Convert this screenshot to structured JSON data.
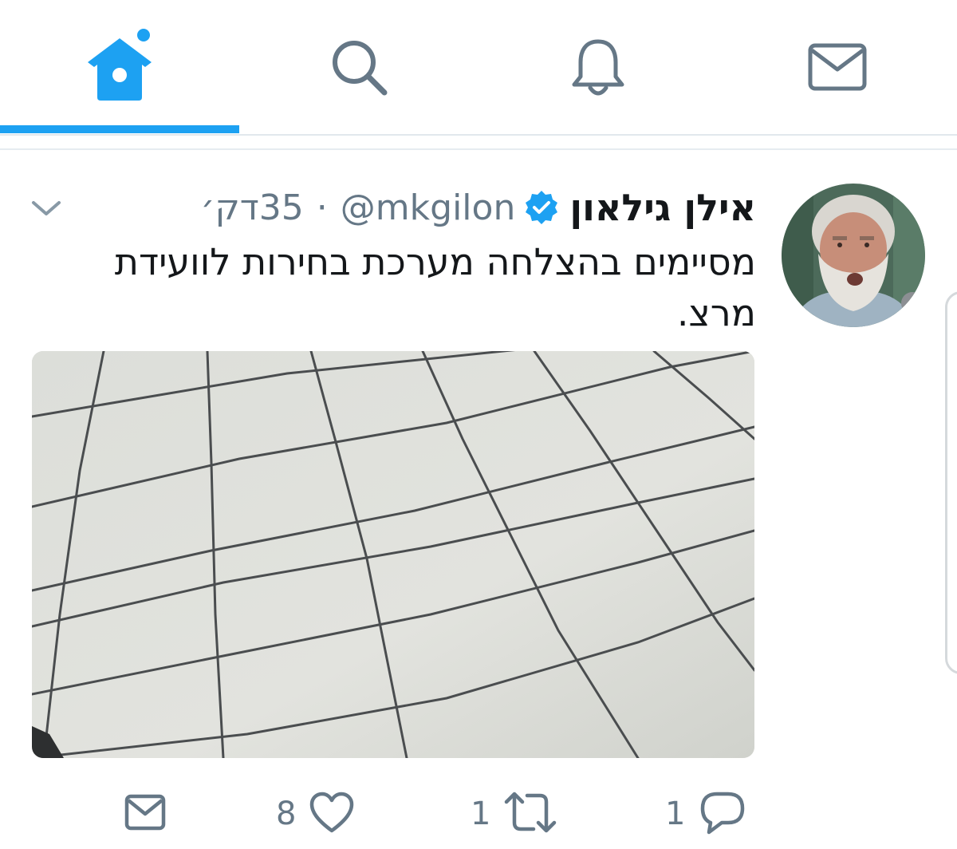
{
  "nav": {
    "tabs": [
      {
        "name": "home",
        "icon": "home-icon",
        "active": true,
        "has_new": true
      },
      {
        "name": "search",
        "icon": "search-icon",
        "active": false
      },
      {
        "name": "notifications",
        "icon": "bell-icon",
        "active": false
      },
      {
        "name": "messages",
        "icon": "mail-icon",
        "active": false
      }
    ],
    "accent_color": "#1da1f2",
    "icon_color": "#657786"
  },
  "tweet": {
    "author_name": "אילן גילאון",
    "verified": true,
    "handle": "@mkgilon",
    "separator": "·",
    "time": "35דק׳",
    "text": "מסיימים בהצלחה מערכת בחירות לוועידת מרצ.",
    "media": {
      "kind": "photo",
      "subject": "tiled floor"
    },
    "actions": {
      "reply_count": "1",
      "retweet_count": "1",
      "like_count": "8"
    }
  }
}
